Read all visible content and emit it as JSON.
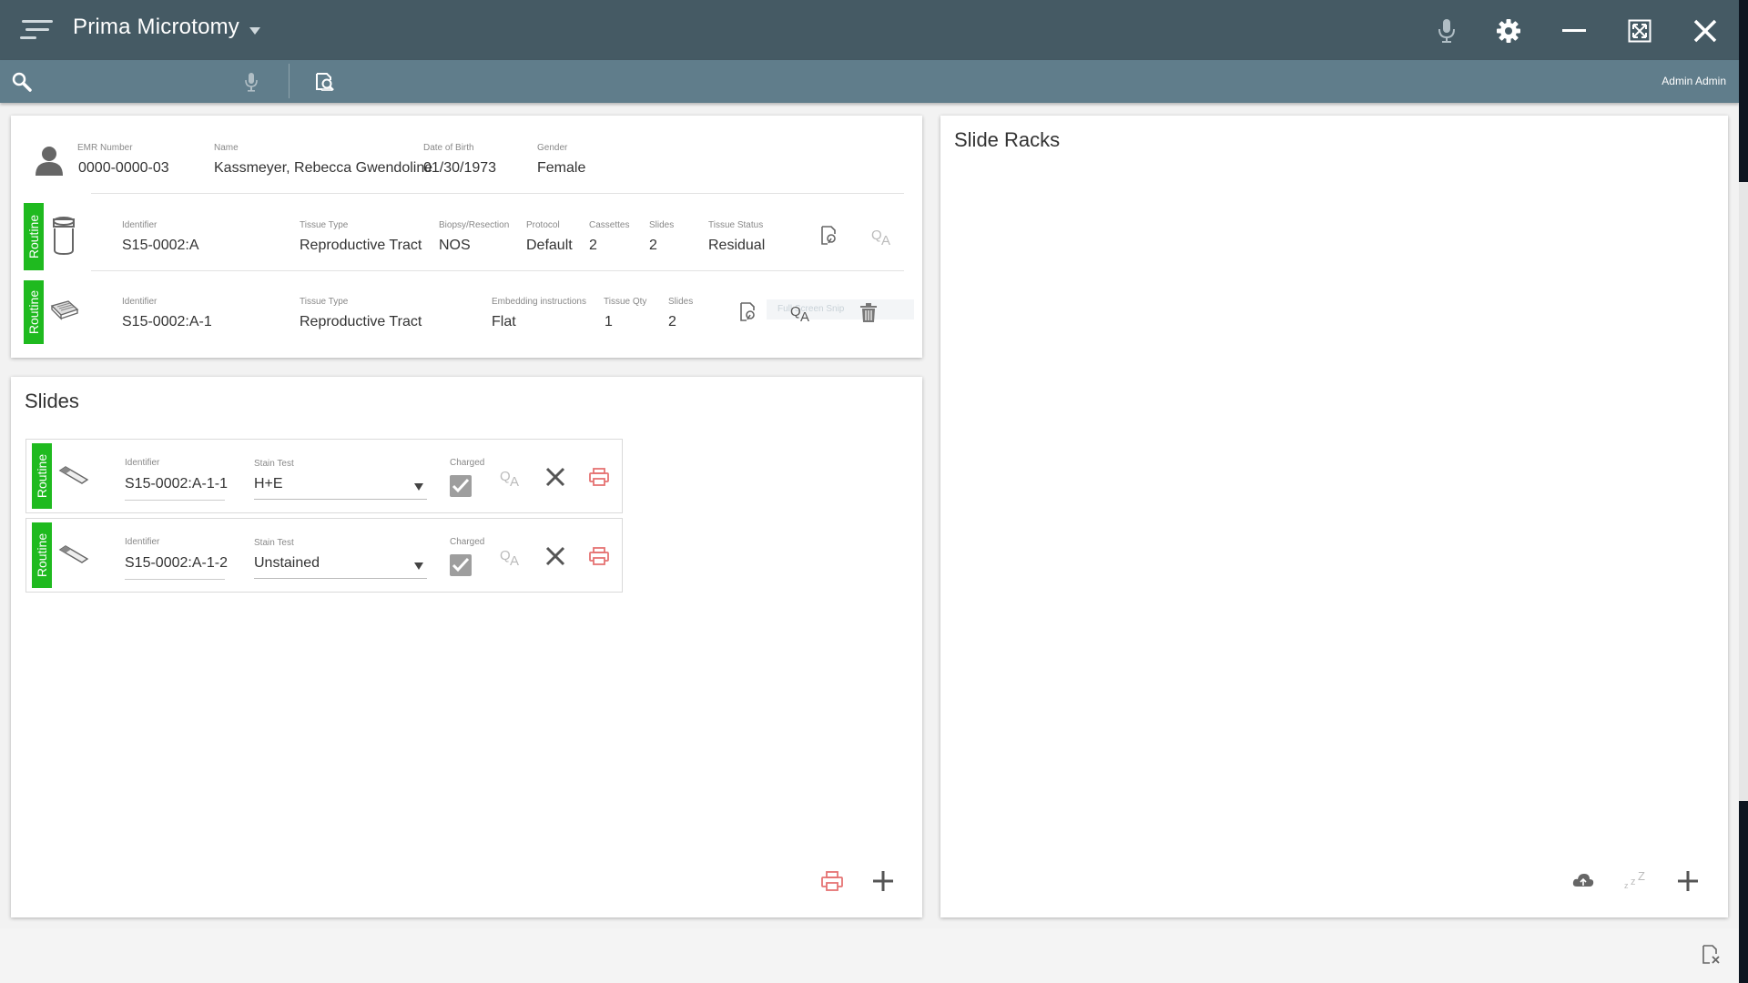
{
  "app": {
    "title": "Prima Microtomy"
  },
  "search": {
    "placeholder": "",
    "user": "Admin Admin"
  },
  "patient": {
    "emr_label": "EMR Number",
    "emr": "0000-0000-03",
    "name_label": "Name",
    "name": "Kassmeyer, Rebecca Gwendoline",
    "dob_label": "Date of Birth",
    "dob": "01/30/1973",
    "gender_label": "Gender",
    "gender": "Female"
  },
  "specimen": {
    "tag": "Routine",
    "identifier_label": "Identifier",
    "identifier": "S15-0002:A",
    "tissue_type_label": "Tissue Type",
    "tissue_type": "Reproductive Tract",
    "biopsy_label": "Biopsy/Resection",
    "biopsy": "NOS",
    "protocol_label": "Protocol",
    "protocol": "Default",
    "cassettes_label": "Cassettes",
    "cassettes": "2",
    "slides_label": "Slides",
    "slides": "2",
    "status_label": "Tissue Status",
    "status": "Residual"
  },
  "cassette": {
    "tag": "Routine",
    "identifier_label": "Identifier",
    "identifier": "S15-0002:A-1",
    "tissue_type_label": "Tissue Type",
    "tissue_type": "Reproductive Tract",
    "embedding_label": "Embedding instructions",
    "embedding": "Flat",
    "qty_label": "Tissue Qty",
    "qty": "1",
    "slides_label": "Slides",
    "slides": "2",
    "faded_text": "Full Screen Snip"
  },
  "slides_panel": {
    "title": "Slides",
    "rows": [
      {
        "tag": "Routine",
        "identifier_label": "Identifier",
        "identifier": "S15-0002:A-1-1",
        "stain_label": "Stain Test",
        "stain": "H+E",
        "charged_label": "Charged",
        "charged": true
      },
      {
        "tag": "Routine",
        "identifier_label": "Identifier",
        "identifier": "S15-0002:A-1-2",
        "stain_label": "Stain Test",
        "stain": "Unstained",
        "charged_label": "Charged",
        "charged": true
      }
    ]
  },
  "racks_panel": {
    "title": "Slide Racks"
  },
  "colors": {
    "titlebar": "#455a64",
    "searchbar": "#607d8b",
    "routine": "#1fba1f",
    "print_accent": "#e57373"
  },
  "icons": {
    "menu": "hamburger-menu-icon",
    "mic": "microphone-icon",
    "settings": "gear-icon",
    "minimize": "minimize-icon",
    "fullscreen": "expand-icon",
    "close": "close-icon",
    "search": "search-icon",
    "scan": "scan-document-icon",
    "patient": "person-icon",
    "specimen": "specimen-jar-icon",
    "cassette": "cassette-icon",
    "slide": "glass-slide-icon",
    "qa": "qa-icon",
    "remove": "x-icon",
    "print": "printer-icon",
    "add": "plus-icon",
    "upload": "cloud-upload-icon",
    "sleep": "sleep-icon",
    "doc_close": "document-close-icon",
    "delete": "trash-icon",
    "edit_doc": "edit-document-icon"
  }
}
